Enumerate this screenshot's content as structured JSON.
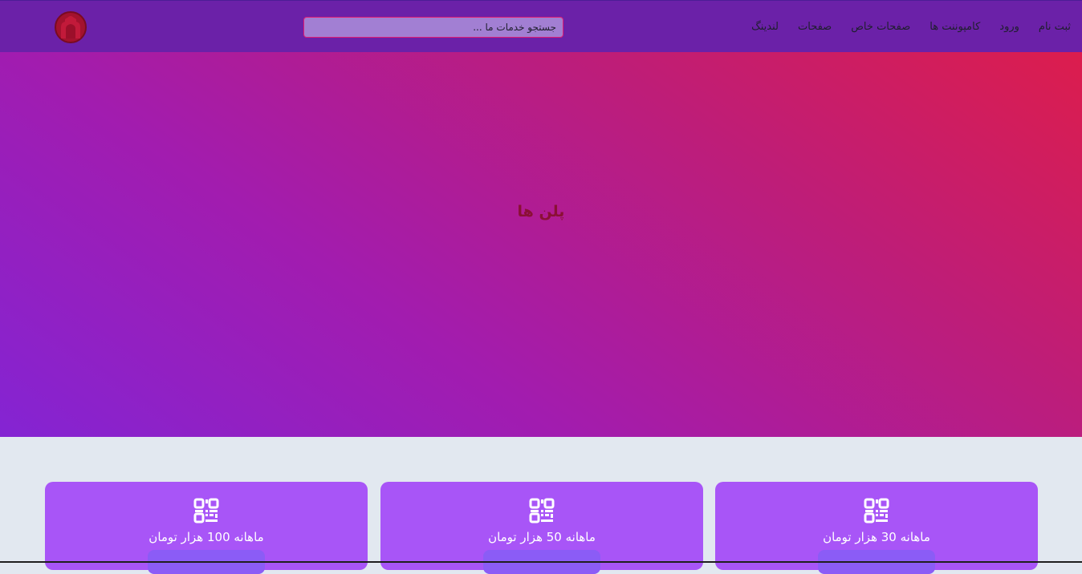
{
  "navbar": {
    "links": [
      "لندینگ",
      "صفحات",
      "صفحات خاص",
      "کامپوننت ها",
      "ورود",
      "ثبت نام"
    ],
    "search_placeholder": "جستجو خدمات ما ..."
  },
  "hero": {
    "title": "پلن ها"
  },
  "plans": [
    {
      "price": "ماهانه 100 هزار تومان",
      "icon": "qr-code-icon"
    },
    {
      "price": "ماهانه 50 هزار تومان",
      "icon": "qr-code-icon"
    },
    {
      "price": "ماهانه 30 هزار تومان",
      "icon": "qr-code-icon"
    }
  ],
  "colors": {
    "navbar": "#6b21a8",
    "card": "#a855f7",
    "card_button": "#8b5cf6",
    "page_background": "#e2e8f0"
  }
}
